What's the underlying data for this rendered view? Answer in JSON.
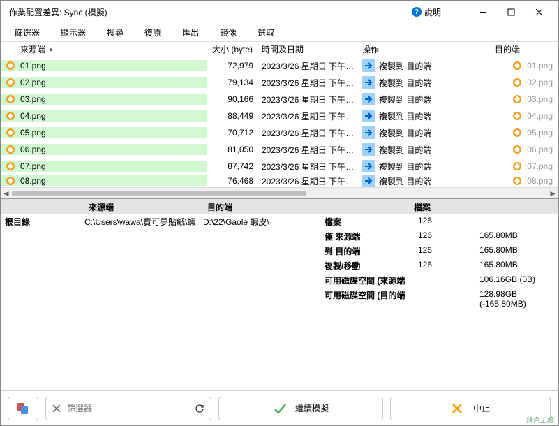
{
  "window": {
    "title": "作業配置差異: Sync (模擬)",
    "help": "說明"
  },
  "menu": [
    "篩選器",
    "顯示器",
    "搜尋",
    "復原",
    "匯出",
    "鏡像",
    "選取"
  ],
  "columns": {
    "source": "來源端",
    "size": "大小 (byte)",
    "date": "時間及日期",
    "op": "操作",
    "target": "目的端"
  },
  "op_label": "複製到 目的端",
  "rows": [
    {
      "name": "01.png",
      "size": "72,979",
      "date": "2023/3/26 星期日 下午",
      "tgt": "01.png"
    },
    {
      "name": "02.png",
      "size": "79,134",
      "date": "2023/3/26 星期日 下午",
      "tgt": "02.png"
    },
    {
      "name": "03.png",
      "size": "90,166",
      "date": "2023/3/26 星期日 下午",
      "tgt": "03.png"
    },
    {
      "name": "04.png",
      "size": "88,449",
      "date": "2023/3/26 星期日 下午",
      "tgt": "04.png"
    },
    {
      "name": "05.png",
      "size": "70,712",
      "date": "2023/3/26 星期日 下午",
      "tgt": "05.png"
    },
    {
      "name": "06.png",
      "size": "81,050",
      "date": "2023/3/26 星期日 下午",
      "tgt": "06.png"
    },
    {
      "name": "07.png",
      "size": "87,742",
      "date": "2023/3/26 星期日 下午",
      "tgt": "07.png"
    },
    {
      "name": "08.png",
      "size": "76,468",
      "date": "2023/3/26 星期日 下午",
      "tgt": "08.png"
    }
  ],
  "info": {
    "head_src": "來源端",
    "head_tgt": "目的端",
    "root_label": "根目錄",
    "root_src": "C:\\Users\\wawa\\寶可夢貼紙\\蝦",
    "root_tgt": "D:\\22\\Gaole 蝦皮\\"
  },
  "stats": {
    "head": "檔案",
    "rows": [
      {
        "k": "檔案",
        "v1": "126",
        "v2": ""
      },
      {
        "k": "僅 來源端",
        "v1": "126",
        "v2": "165.80MB"
      },
      {
        "k": "到 目的端",
        "v1": "126",
        "v2": "165.80MB"
      },
      {
        "k": "複製/移動",
        "v1": "126",
        "v2": "165.80MB"
      },
      {
        "k": "可用磁碟空間 (來源端",
        "v1": "",
        "v2": "106.16GB (0B)"
      },
      {
        "k": "可用磁碟空間 (目的端",
        "v1": "",
        "v2": "128.98GB (-165.80MB)"
      }
    ]
  },
  "bottom": {
    "filter_placeholder": "篩選器",
    "continue": "繼續模擬",
    "stop": "中止"
  },
  "watermark": "綠色工廠"
}
